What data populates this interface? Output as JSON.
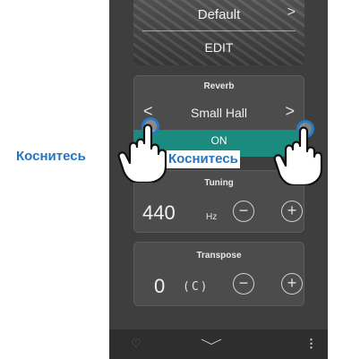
{
  "sound": {
    "name": "Default",
    "edit_label": "EDIT"
  },
  "reverb": {
    "title": "Reverb",
    "value": "Small Hall",
    "status": "ON"
  },
  "tuning": {
    "title": "Tuning",
    "value": "440",
    "unit": "Hz"
  },
  "transpose": {
    "title": "Transpose",
    "value": "0",
    "key": "(C)"
  },
  "callouts": {
    "left": "Коснитесь",
    "right": "Коснитесь"
  },
  "icons": {
    "heart": "heart-icon",
    "chevron_down": "chevron-down-icon",
    "more": "more-icon",
    "hand": "hand-pointer-icon",
    "minus": "minus-icon",
    "plus": "plus-icon"
  },
  "colors": {
    "accent": "#1b8a7f",
    "callout": "#2775c0"
  }
}
